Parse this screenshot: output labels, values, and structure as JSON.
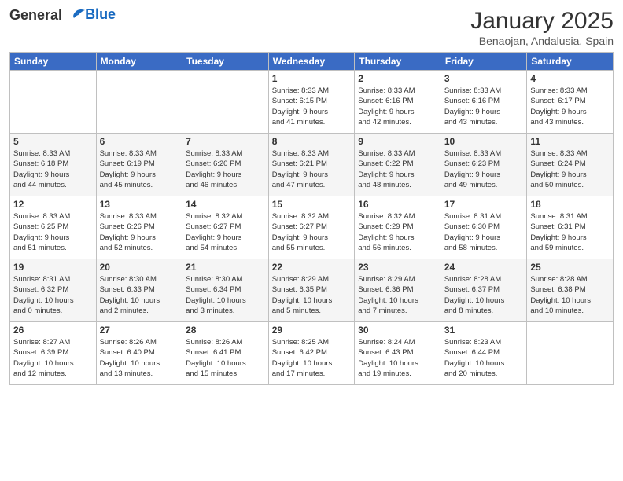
{
  "header": {
    "logo_line1": "General",
    "logo_line2": "Blue",
    "month_title": "January 2025",
    "subtitle": "Benaojan, Andalusia, Spain"
  },
  "days_of_week": [
    "Sunday",
    "Monday",
    "Tuesday",
    "Wednesday",
    "Thursday",
    "Friday",
    "Saturday"
  ],
  "weeks": [
    [
      {
        "num": "",
        "info": ""
      },
      {
        "num": "",
        "info": ""
      },
      {
        "num": "",
        "info": ""
      },
      {
        "num": "1",
        "info": "Sunrise: 8:33 AM\nSunset: 6:15 PM\nDaylight: 9 hours\nand 41 minutes."
      },
      {
        "num": "2",
        "info": "Sunrise: 8:33 AM\nSunset: 6:16 PM\nDaylight: 9 hours\nand 42 minutes."
      },
      {
        "num": "3",
        "info": "Sunrise: 8:33 AM\nSunset: 6:16 PM\nDaylight: 9 hours\nand 43 minutes."
      },
      {
        "num": "4",
        "info": "Sunrise: 8:33 AM\nSunset: 6:17 PM\nDaylight: 9 hours\nand 43 minutes."
      }
    ],
    [
      {
        "num": "5",
        "info": "Sunrise: 8:33 AM\nSunset: 6:18 PM\nDaylight: 9 hours\nand 44 minutes."
      },
      {
        "num": "6",
        "info": "Sunrise: 8:33 AM\nSunset: 6:19 PM\nDaylight: 9 hours\nand 45 minutes."
      },
      {
        "num": "7",
        "info": "Sunrise: 8:33 AM\nSunset: 6:20 PM\nDaylight: 9 hours\nand 46 minutes."
      },
      {
        "num": "8",
        "info": "Sunrise: 8:33 AM\nSunset: 6:21 PM\nDaylight: 9 hours\nand 47 minutes."
      },
      {
        "num": "9",
        "info": "Sunrise: 8:33 AM\nSunset: 6:22 PM\nDaylight: 9 hours\nand 48 minutes."
      },
      {
        "num": "10",
        "info": "Sunrise: 8:33 AM\nSunset: 6:23 PM\nDaylight: 9 hours\nand 49 minutes."
      },
      {
        "num": "11",
        "info": "Sunrise: 8:33 AM\nSunset: 6:24 PM\nDaylight: 9 hours\nand 50 minutes."
      }
    ],
    [
      {
        "num": "12",
        "info": "Sunrise: 8:33 AM\nSunset: 6:25 PM\nDaylight: 9 hours\nand 51 minutes."
      },
      {
        "num": "13",
        "info": "Sunrise: 8:33 AM\nSunset: 6:26 PM\nDaylight: 9 hours\nand 52 minutes."
      },
      {
        "num": "14",
        "info": "Sunrise: 8:32 AM\nSunset: 6:27 PM\nDaylight: 9 hours\nand 54 minutes."
      },
      {
        "num": "15",
        "info": "Sunrise: 8:32 AM\nSunset: 6:27 PM\nDaylight: 9 hours\nand 55 minutes."
      },
      {
        "num": "16",
        "info": "Sunrise: 8:32 AM\nSunset: 6:29 PM\nDaylight: 9 hours\nand 56 minutes."
      },
      {
        "num": "17",
        "info": "Sunrise: 8:31 AM\nSunset: 6:30 PM\nDaylight: 9 hours\nand 58 minutes."
      },
      {
        "num": "18",
        "info": "Sunrise: 8:31 AM\nSunset: 6:31 PM\nDaylight: 9 hours\nand 59 minutes."
      }
    ],
    [
      {
        "num": "19",
        "info": "Sunrise: 8:31 AM\nSunset: 6:32 PM\nDaylight: 10 hours\nand 0 minutes."
      },
      {
        "num": "20",
        "info": "Sunrise: 8:30 AM\nSunset: 6:33 PM\nDaylight: 10 hours\nand 2 minutes."
      },
      {
        "num": "21",
        "info": "Sunrise: 8:30 AM\nSunset: 6:34 PM\nDaylight: 10 hours\nand 3 minutes."
      },
      {
        "num": "22",
        "info": "Sunrise: 8:29 AM\nSunset: 6:35 PM\nDaylight: 10 hours\nand 5 minutes."
      },
      {
        "num": "23",
        "info": "Sunrise: 8:29 AM\nSunset: 6:36 PM\nDaylight: 10 hours\nand 7 minutes."
      },
      {
        "num": "24",
        "info": "Sunrise: 8:28 AM\nSunset: 6:37 PM\nDaylight: 10 hours\nand 8 minutes."
      },
      {
        "num": "25",
        "info": "Sunrise: 8:28 AM\nSunset: 6:38 PM\nDaylight: 10 hours\nand 10 minutes."
      }
    ],
    [
      {
        "num": "26",
        "info": "Sunrise: 8:27 AM\nSunset: 6:39 PM\nDaylight: 10 hours\nand 12 minutes."
      },
      {
        "num": "27",
        "info": "Sunrise: 8:26 AM\nSunset: 6:40 PM\nDaylight: 10 hours\nand 13 minutes."
      },
      {
        "num": "28",
        "info": "Sunrise: 8:26 AM\nSunset: 6:41 PM\nDaylight: 10 hours\nand 15 minutes."
      },
      {
        "num": "29",
        "info": "Sunrise: 8:25 AM\nSunset: 6:42 PM\nDaylight: 10 hours\nand 17 minutes."
      },
      {
        "num": "30",
        "info": "Sunrise: 8:24 AM\nSunset: 6:43 PM\nDaylight: 10 hours\nand 19 minutes."
      },
      {
        "num": "31",
        "info": "Sunrise: 8:23 AM\nSunset: 6:44 PM\nDaylight: 10 hours\nand 20 minutes."
      },
      {
        "num": "",
        "info": ""
      }
    ]
  ]
}
